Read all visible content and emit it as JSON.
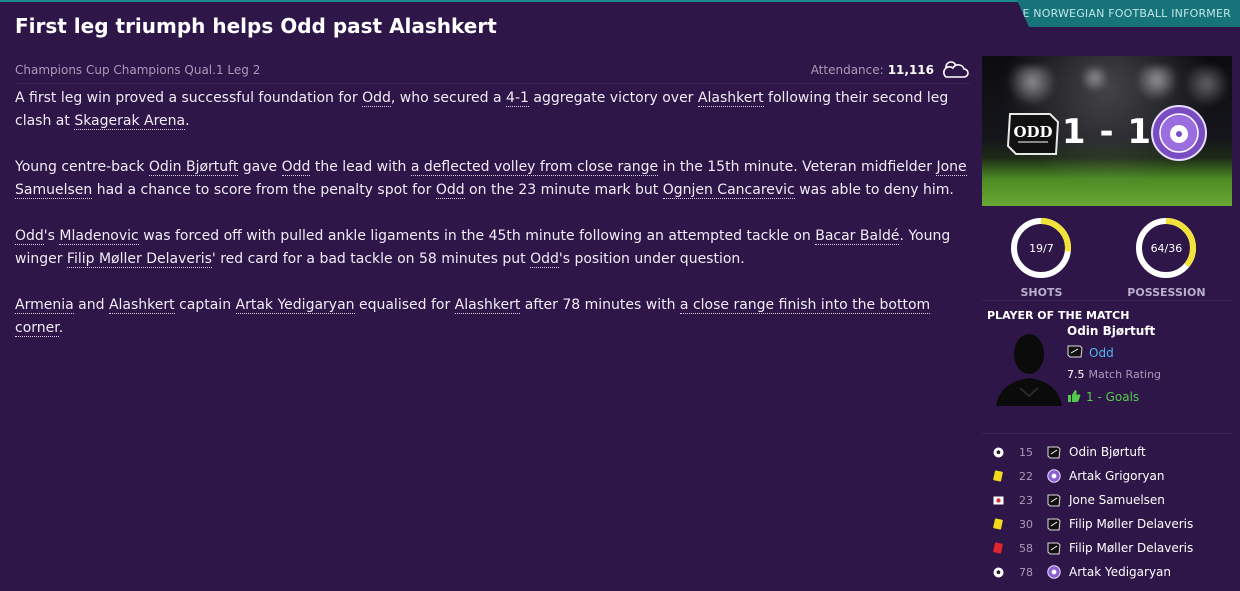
{
  "source": "THE NORWEGIAN FOOTBALL INFORMER",
  "headline": "First leg triumph helps Odd past Alashkert",
  "competition": "Champions Cup Champions Qual.1 Leg 2",
  "attendance": {
    "label": "Attendance:",
    "value": "11,116",
    "weather": "cloudy-icon"
  },
  "article": {
    "p1": {
      "t1": "A first leg win proved a successful foundation for ",
      "l1": "Odd",
      "t2": ", who secured a ",
      "l2": "4-1",
      "t3": " aggregate victory over ",
      "l3": "Alashkert",
      "t4": " following their second leg clash at ",
      "l4": "Skagerak Arena",
      "t5": "."
    },
    "p2": {
      "t1": "Young centre-back ",
      "l1": "Odin Bjørtuft",
      "t2": " gave ",
      "l2": "Odd",
      "t3": " the lead with ",
      "l3": "a deflected volley from close range",
      "t4": " in the 15th minute. Veteran midfielder ",
      "l4": "Jone Samuelsen",
      "t5": " had a chance to score from the penalty spot for ",
      "l5": "Odd",
      "t6": " on the 23 minute mark but ",
      "l6": "Ognjen Cancarevic",
      "t7": " was able to deny him."
    },
    "p3": {
      "l1": "Odd",
      "t1": "'s ",
      "l2": "Mladenovic",
      "t2": " was forced off with pulled ankle ligaments in the 45th minute following an attempted tackle on ",
      "l3": "Bacar Baldé",
      "t3": ". Young winger ",
      "l4": "Filip Møller Delaveris",
      "t4": "' red card for a bad tackle on 58 minutes put ",
      "l5": "Odd",
      "t5": "'s position under question."
    },
    "p4": {
      "l1": "Armenia",
      "t1": " and ",
      "l2": "Alashkert",
      "t2": " captain ",
      "l3": "Artak Yedigaryan",
      "t3": " equalised for ",
      "l4": "Alashkert",
      "t4": " after 78 minutes with ",
      "l5": "a close range finish into the bottom corner",
      "t5": "."
    }
  },
  "match": {
    "home_score": "1",
    "separator": "-",
    "away_score": "1",
    "home_crest": "odd-crest-icon",
    "away_crest": "alashkert-crest-icon"
  },
  "stats": {
    "shots": {
      "value": "19/7",
      "label": "SHOTS",
      "home_share": 0.73
    },
    "possession": {
      "value": "64/36",
      "label": "POSSESSION",
      "home_share": 0.64
    },
    "colors": {
      "home": "#ffffff",
      "away": "#f2e33a"
    }
  },
  "potm": {
    "title": "PLAYER OF THE MATCH",
    "name": "Odin Bjørtuft",
    "club": "Odd",
    "rating": "7.5",
    "rating_label": "Match Rating",
    "goals": "1 - Goals"
  },
  "events": [
    {
      "type": "goal",
      "minute": "15",
      "team": "odd",
      "player": "Odin Bjørtuft"
    },
    {
      "type": "yellow",
      "minute": "22",
      "team": "alashkert",
      "player": "Artak Grigoryan"
    },
    {
      "type": "penalty-miss",
      "minute": "23",
      "team": "odd",
      "player": "Jone Samuelsen"
    },
    {
      "type": "yellow",
      "minute": "30",
      "team": "odd",
      "player": "Filip Møller Delaveris"
    },
    {
      "type": "red",
      "minute": "58",
      "team": "odd",
      "player": "Filip Møller Delaveris"
    },
    {
      "type": "goal",
      "minute": "78",
      "team": "alashkert",
      "player": "Artak Yedigaryan"
    }
  ]
}
